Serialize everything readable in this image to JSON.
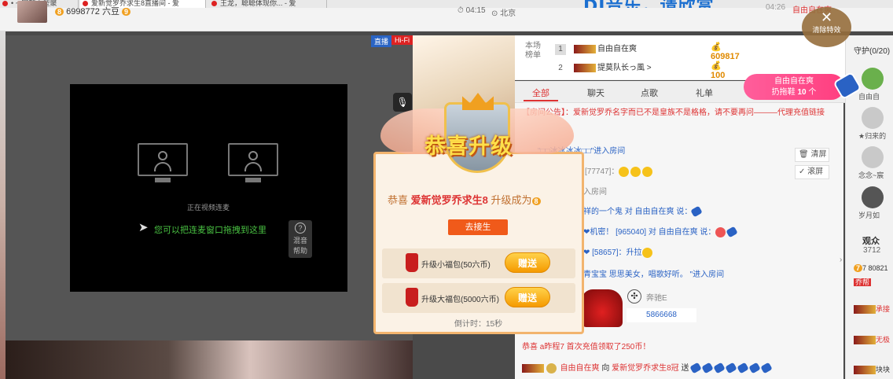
{
  "tabs": [
    {
      "label": "• ~ 网趣大型聚"
    },
    {
      "label": "爱新觉罗乔求生8直播间 - 爱"
    },
    {
      "label": "王龙，聪聪体现你... - 爱"
    }
  ],
  "banner": {
    "text": "DJ音乐，请欣赏"
  },
  "header": {
    "level": "8",
    "room_id": "6998772",
    "currency_label": "六豆",
    "currency_level": "9",
    "time": "04:15",
    "city": "北京",
    "time_right": "04:26",
    "right_text": "自由自在爽"
  },
  "effects": {
    "close_label": "清除特效"
  },
  "video": {
    "live_badge": "直播",
    "hifi_badge": "Hi-Fi",
    "connecting_text": "正在视频连麦",
    "drag_hint": "您可以把连麦窗口拖拽到这里",
    "help_label_1": "混音",
    "help_label_2": "帮助",
    "help_q": "?"
  },
  "ranking": {
    "label": "本场榜单",
    "rows": [
      {
        "rank": "1",
        "name": "自由自在爽",
        "score": "609817"
      },
      {
        "rank": "2",
        "name": "提莫队长っ風 >",
        "score": "100"
      }
    ]
  },
  "chat_tabs": [
    {
      "label": "全部"
    },
    {
      "label": "聊天"
    },
    {
      "label": "点歌"
    },
    {
      "label": "礼单"
    }
  ],
  "chat": {
    "notice": "【房间公告】：爱新觉罗乔名字而已不是皇族不是格格，请不要再问———代理充值链接",
    "enter1": "\"□□冰冰冰冰□□\"进入房间",
    "msg1_id": "[77747]：",
    "enter2": "入房间",
    "msg2": "祥的一个鬼 对 自由自在爽 说：",
    "msg3": "❤机密！ [965040] 对 自由自在爽 说：",
    "msg4": "❤ [58657]：升拉",
    "msg5": "青宝宝 思思美女，唱歌好听。 \"进入房间",
    "car_brand": "奔驰E",
    "car_id": "5866668",
    "recharge": "恭喜 a昨程7 首次充值领取了250币！",
    "gift_line_from": "自由自在爽",
    "gift_line_to": "爱新觉罗乔求生8冠",
    "gift_line_verb": "向",
    "gift_line_send": "送"
  },
  "side_buttons": {
    "clear": "清屏",
    "scroll": "滚屏"
  },
  "gift_banner": {
    "name": "自由自在爽",
    "text": "扔拖鞋",
    "count": "10",
    "unit": "个"
  },
  "guard": {
    "title": "守护(0/20)",
    "members": [
      {
        "name": "自由自"
      },
      {
        "name": "★归来的"
      },
      {
        "name": "念念~宸"
      },
      {
        "name": "岁月如"
      }
    ]
  },
  "audience": {
    "title": "观众",
    "count": "3712",
    "rows": [
      {
        "text": "7 80821"
      },
      {
        "text": "乔帮"
      },
      {
        "text": "承接"
      },
      {
        "text": "无极"
      },
      {
        "text": "块块"
      }
    ]
  },
  "levelup": {
    "crest_text": "恭喜升级",
    "prefix": "恭喜",
    "name": "爱新觉罗乔求生8",
    "suffix": "升级成为",
    "new_level": "8",
    "go_button": "去接生",
    "packages": [
      {
        "label": "升级小福包(50六币)",
        "button": "赠送"
      },
      {
        "label": "升级大福包(5000六币)",
        "button": "赠送"
      }
    ],
    "countdown": "倒计时：15秒"
  },
  "colors": {
    "accent": "#d33333",
    "orange": "#f05a1a",
    "live_blue": "#2a64c4",
    "pink": "#ff4e8f"
  }
}
